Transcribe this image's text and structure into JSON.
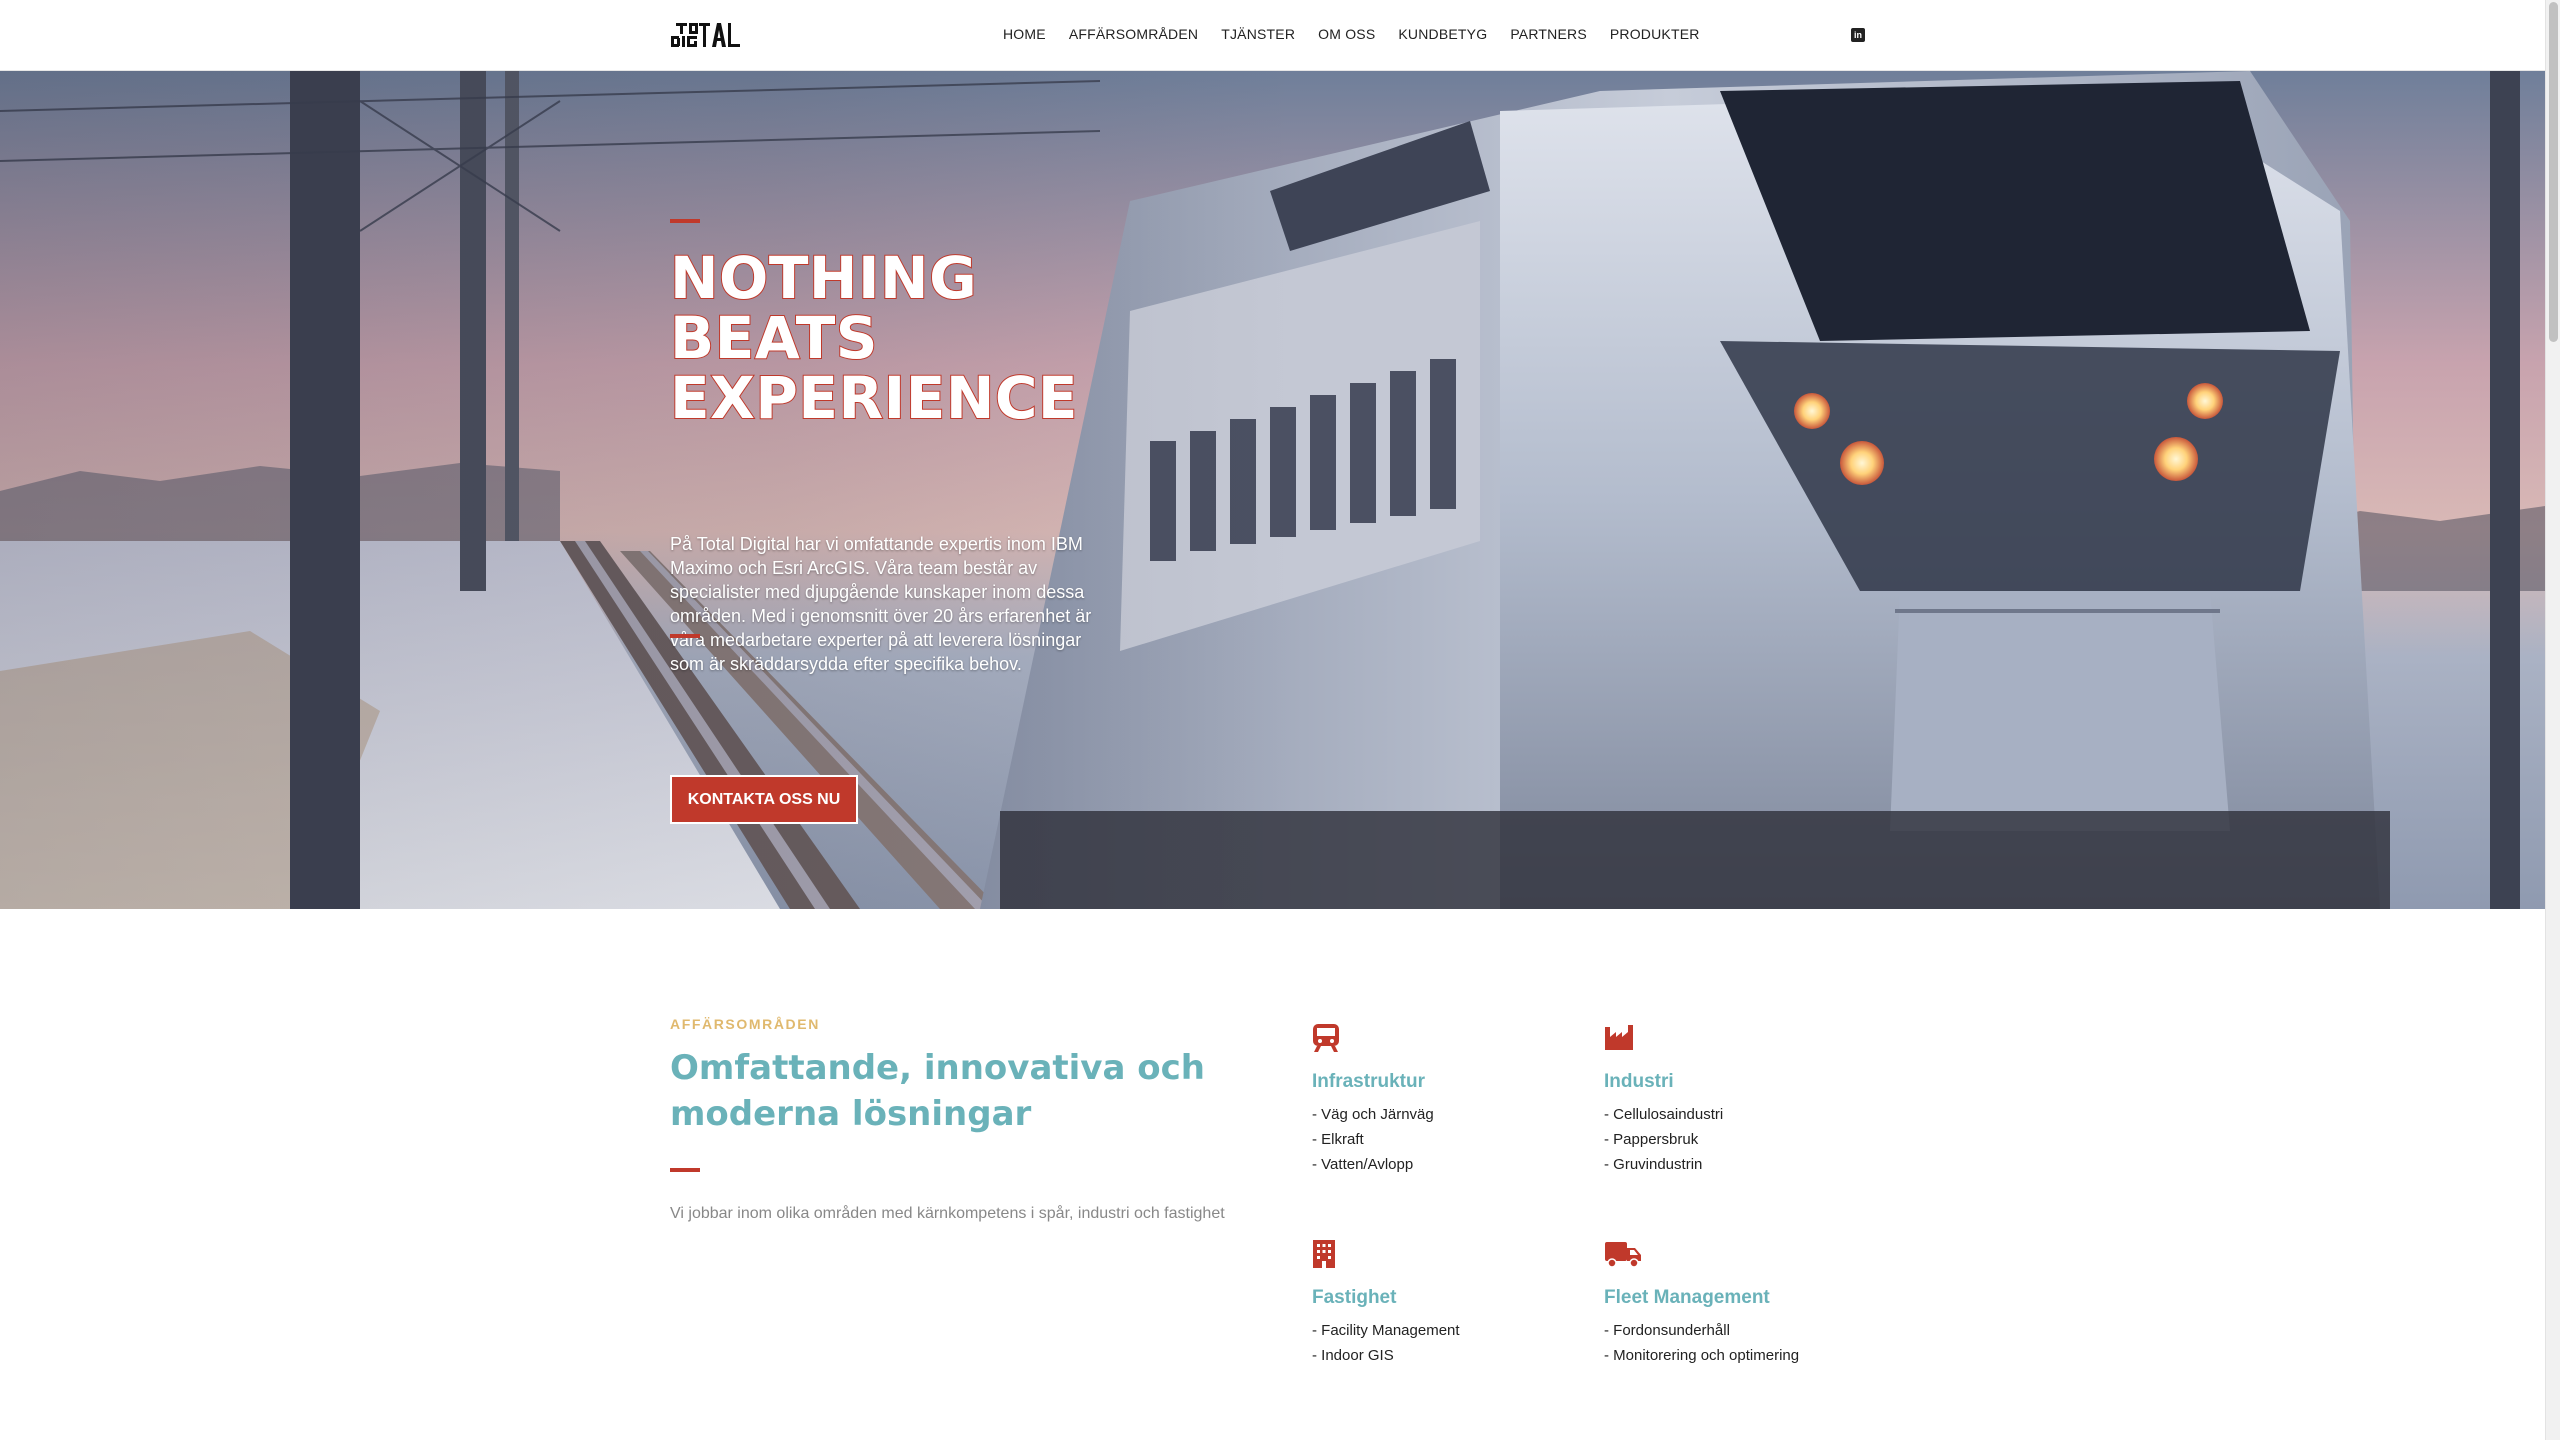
{
  "header": {
    "logo_text": "TOTAL DIGITAL",
    "nav": [
      "HOME",
      "AFFÄRSOMRÅDEN",
      "TJÄNSTER",
      "OM OSS",
      "KUNDBETYG",
      "PARTNERS",
      "PRODUKTER"
    ],
    "social_icon": "linkedin-icon"
  },
  "hero": {
    "title_lines": [
      "NOTHING",
      "BEATS",
      "EXPERIENCE"
    ],
    "body": "På Total Digital har vi omfattande expertis inom IBM Maximo och Esri ArcGIS. Våra team består av specialister med djupgående kunskaper inom dessa områden. Med i genomsnitt över 20 års erfarenhet är våra medarbetare experter på att leverera lösningar som är skräddarsydda efter specifika behov.",
    "button_label": "KONTAKTA OSS NU",
    "image": "high-speed-train-in-snow"
  },
  "business": {
    "eyebrow": "AFFÄRSOMRÅDEN",
    "title": "Omfattande, innovativa och moderna lösningar",
    "text": "Vi jobbar inom olika områden med kärnkompetens i spår, industri och fastighet",
    "areas": [
      {
        "icon": "train-icon",
        "title": "Infrastruktur",
        "items": [
          "- Väg och Järnväg",
          "- Elkraft",
          "- Vatten/Avlopp"
        ]
      },
      {
        "icon": "industry-icon",
        "title": "Industri",
        "items": [
          "- Cellulosaindustri",
          "- Pappersbruk",
          "- Gruvindustrin"
        ]
      },
      {
        "icon": "building-icon",
        "title": "Fastighet",
        "items": [
          "- Facility Management",
          "- Indoor GIS"
        ]
      },
      {
        "icon": "truck-icon",
        "title": "Fleet Management",
        "items": [
          "- Fordonsunderhåll",
          "- Monitorering och optimering"
        ]
      }
    ]
  },
  "colors": {
    "accent_red": "#c0392b",
    "teal": "#6ab2b9",
    "gold": "#e0b96e"
  }
}
